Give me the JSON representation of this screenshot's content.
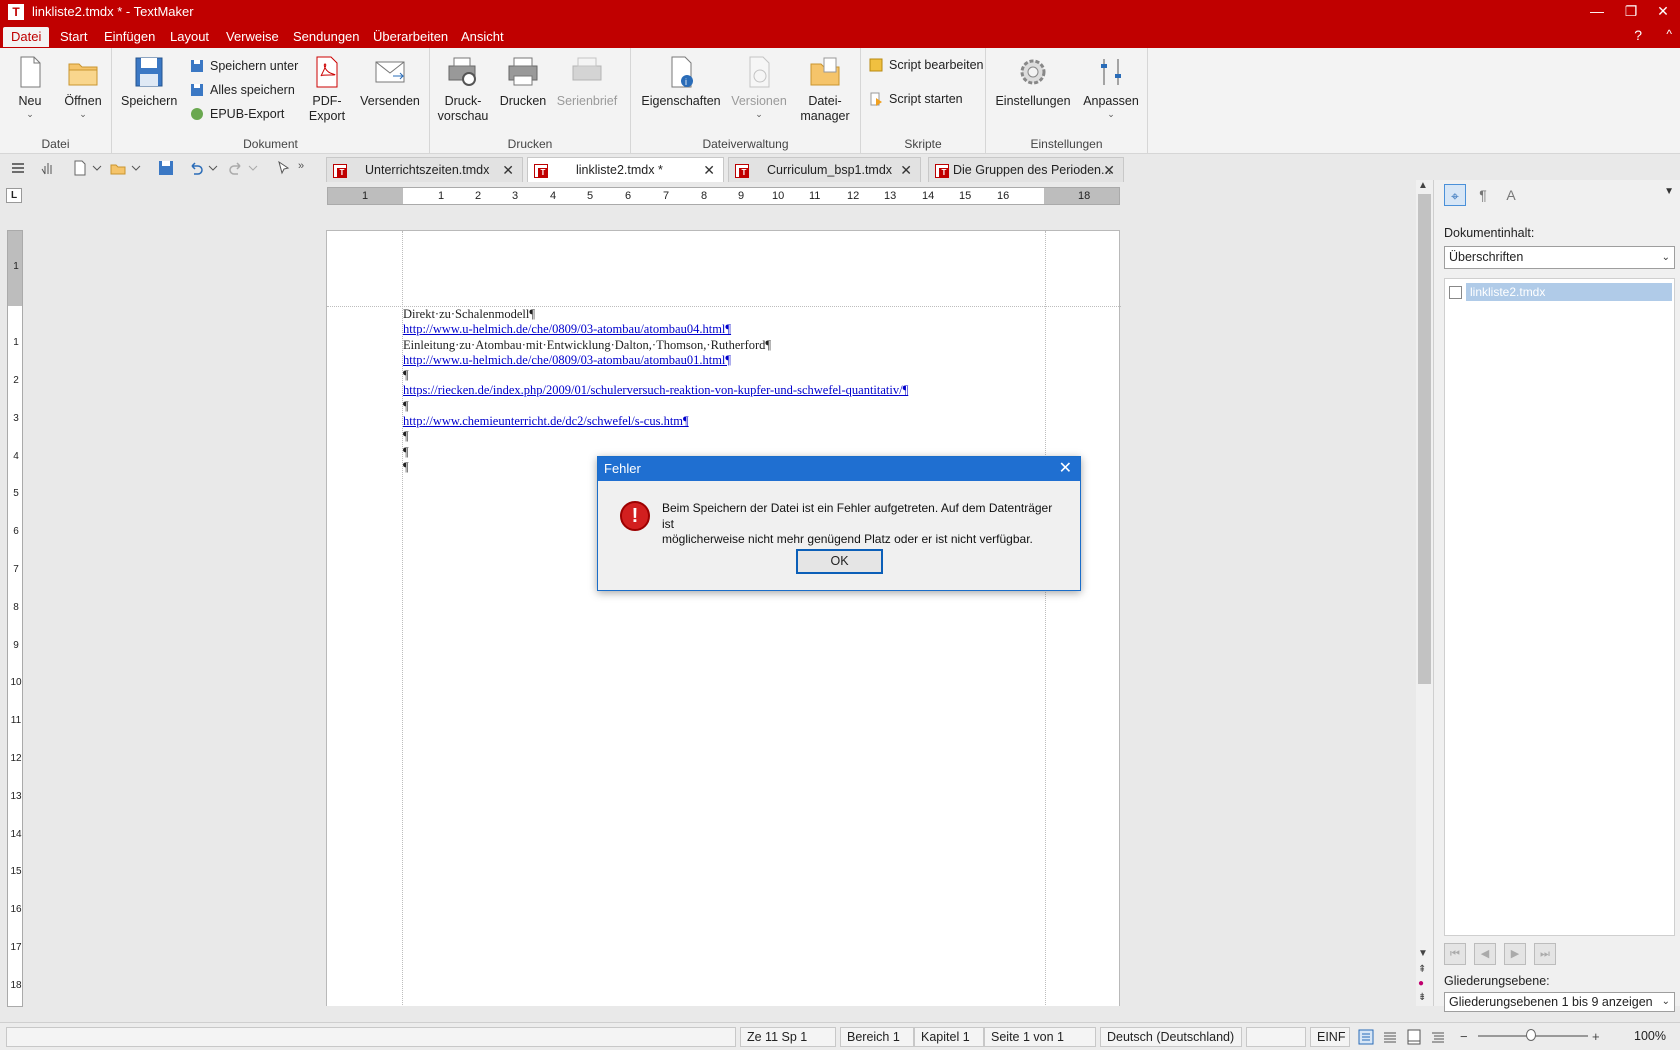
{
  "window": {
    "title": "linkliste2.tmdx * - TextMaker",
    "app_icon": "T",
    "minimize": "—",
    "restore": "❐",
    "close": "✕"
  },
  "menu": {
    "items": [
      "Datei",
      "Start",
      "Einfügen",
      "Layout",
      "Verweise",
      "Sendungen",
      "Überarbeiten",
      "Ansicht"
    ],
    "help": "?",
    "collapse": "^"
  },
  "ribbon": {
    "groups": {
      "datei": "Datei",
      "dokument": "Dokument",
      "drucken": "Drucken",
      "dateiverwaltung": "Dateiverwaltung",
      "skripte": "Skripte",
      "einstellungen": "Einstellungen"
    },
    "buttons": {
      "neu": "Neu",
      "oeffnen": "Öffnen",
      "speichern": "Speichern",
      "speichern_unter": "Speichern unter",
      "alles_speichern": "Alles speichern",
      "epub_export": "EPUB-Export",
      "pdf_export_1": "PDF-",
      "pdf_export_2": "Export",
      "versenden": "Versenden",
      "druckvorschau_1": "Druck-",
      "druckvorschau_2": "vorschau",
      "drucken": "Drucken",
      "serienbrief": "Serienbrief",
      "eigenschaften": "Eigenschaften",
      "versionen": "Versionen",
      "dateimanager_1": "Datei-",
      "dateimanager_2": "manager",
      "script_bearbeiten": "Script bearbeiten",
      "script_starten": "Script starten",
      "einstellungen": "Einstellungen",
      "anpassen": "Anpassen"
    }
  },
  "tabs": [
    {
      "label": "Unterrichtszeiten.tmdx"
    },
    {
      "label": "linkliste2.tmdx *"
    },
    {
      "label": "Curriculum_bsp1.tmdx"
    },
    {
      "label": "Die Gruppen des Perioden..."
    }
  ],
  "tab_close": "✕",
  "ruler": {
    "corner": "L",
    "h_ticks": [
      "1",
      "1",
      "2",
      "3",
      "4",
      "5",
      "6",
      "7",
      "8",
      "9",
      "10",
      "11",
      "12",
      "13",
      "14",
      "15",
      "16",
      "18"
    ],
    "v_ticks": [
      "1",
      "1",
      "2",
      "3",
      "4",
      "5",
      "6",
      "7",
      "8",
      "9",
      "10",
      "11",
      "12",
      "13",
      "14",
      "15",
      "16",
      "17",
      "18"
    ]
  },
  "document": {
    "paragraphs": [
      {
        "text": "Direkt·zu·Schalenmodell¶",
        "link": false
      },
      {
        "text": "http://www.u-helmich.de/che/0809/03-atombau/atombau04.html¶",
        "link": true
      },
      {
        "text": "Einleitung·zu·Atombau·mit·Entwicklung·Dalton,·Thomson,·Rutherford¶",
        "link": false
      },
      {
        "text": "http://www.u-helmich.de/che/0809/03-atombau/atombau01.html¶",
        "link": true
      },
      {
        "text": "¶",
        "link": false
      },
      {
        "text": "https://riecken.de/index.php/2009/01/schulerversuch-reaktion-von-kupfer-und-schwefel-quantitativ/¶",
        "link": true
      },
      {
        "text": "¶",
        "link": false
      },
      {
        "text": "http://www.chemieunterricht.de/dc2/schwefel/s-cus.htm¶",
        "link": true
      },
      {
        "text": "¶",
        "link": false
      },
      {
        "text": "¶",
        "link": false
      },
      {
        "text": "¶",
        "link": false
      }
    ]
  },
  "sidepanel": {
    "content_label": "Dokumentinhalt:",
    "content_select": "Überschriften",
    "tree_item": "linkliste2.tmdx",
    "outline_label": "Gliederungsebene:",
    "outline_select": "Gliederungsebenen 1 bis 9 anzeigen"
  },
  "statusbar": {
    "position": "Ze 11 Sp 1",
    "bereich": "Bereich 1",
    "kapitel": "Kapitel 1",
    "seite": "Seite 1 von 1",
    "sprache": "Deutsch (Deutschland)",
    "mode": "EINF",
    "zoom": "100%",
    "zoom_minus": "−",
    "zoom_plus": "+"
  },
  "dialog": {
    "title": "Fehler",
    "message_line1": "Beim Speichern der Datei ist ein Fehler aufgetreten. Auf dem Datenträger ist",
    "message_line2": "möglicherweise nicht mehr genügend Platz oder er ist nicht verfügbar.",
    "ok": "OK",
    "close": "✕",
    "icon": "!"
  },
  "colors": {
    "brand": "#c00000",
    "dialog_title": "#1f6fd1",
    "link": "#0000cc"
  }
}
